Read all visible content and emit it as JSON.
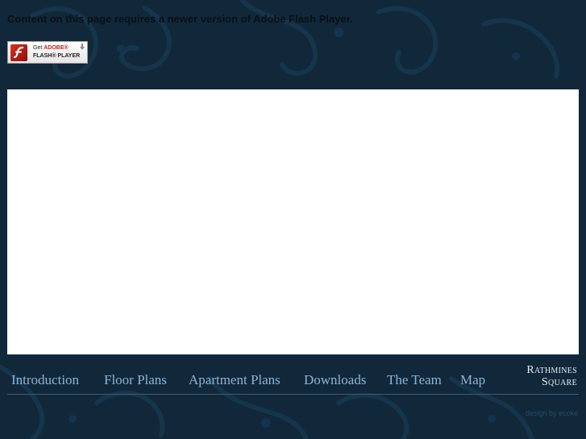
{
  "flash_notice": {
    "message": "Content on this page requires a newer version of Adobe Flash Player.",
    "badge": {
      "get": "Get",
      "adobe": "ADOBE®",
      "player": "FLASH® PLAYER"
    }
  },
  "nav": {
    "items": [
      {
        "label": "Introduction"
      },
      {
        "label": "Floor Plans"
      },
      {
        "label": "Apartment Plans"
      },
      {
        "label": "Downloads"
      },
      {
        "label": "The Team"
      },
      {
        "label": "Map"
      }
    ]
  },
  "brand": {
    "line1": "Rathmines",
    "line2": "Square"
  },
  "footer": {
    "credit": "design by ecoke"
  },
  "colors": {
    "background": "#10283a",
    "nav_text": "#8fb4d2",
    "flash_area": "#ffffff",
    "notice_text": "#0b0f14"
  }
}
